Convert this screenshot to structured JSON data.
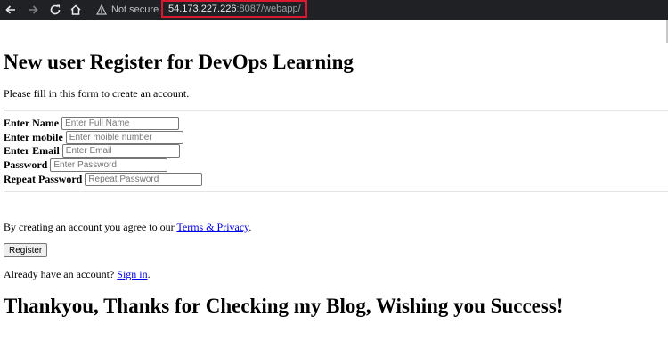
{
  "browser": {
    "security_label": "Not secure",
    "url_host": "54.173.227.226",
    "url_path": ":8087/webapp/",
    "accent_highlight": "#d9192f"
  },
  "page": {
    "title": "New user Register for DevOps Learning",
    "intro": "Please fill in this form to create an account.",
    "fields": [
      {
        "label": "Enter Name",
        "placeholder": "Enter Full Name"
      },
      {
        "label": "Enter mobile",
        "placeholder": "Enter moible number"
      },
      {
        "label": "Enter Email",
        "placeholder": "Enter Email"
      },
      {
        "label": "Password",
        "placeholder": "Enter Password"
      },
      {
        "label": "Repeat Password",
        "placeholder": "Repeat Password"
      }
    ],
    "agree_text": "By creating an account you agree to our ",
    "terms_link": "Terms & Privacy",
    "agree_end": ".",
    "register_button": "Register",
    "signin_text": "Already have an account? ",
    "signin_link": "Sign in",
    "signin_end": ".",
    "thanks": "Thankyou, Thanks for Checking my Blog, Wishing you Success!"
  }
}
